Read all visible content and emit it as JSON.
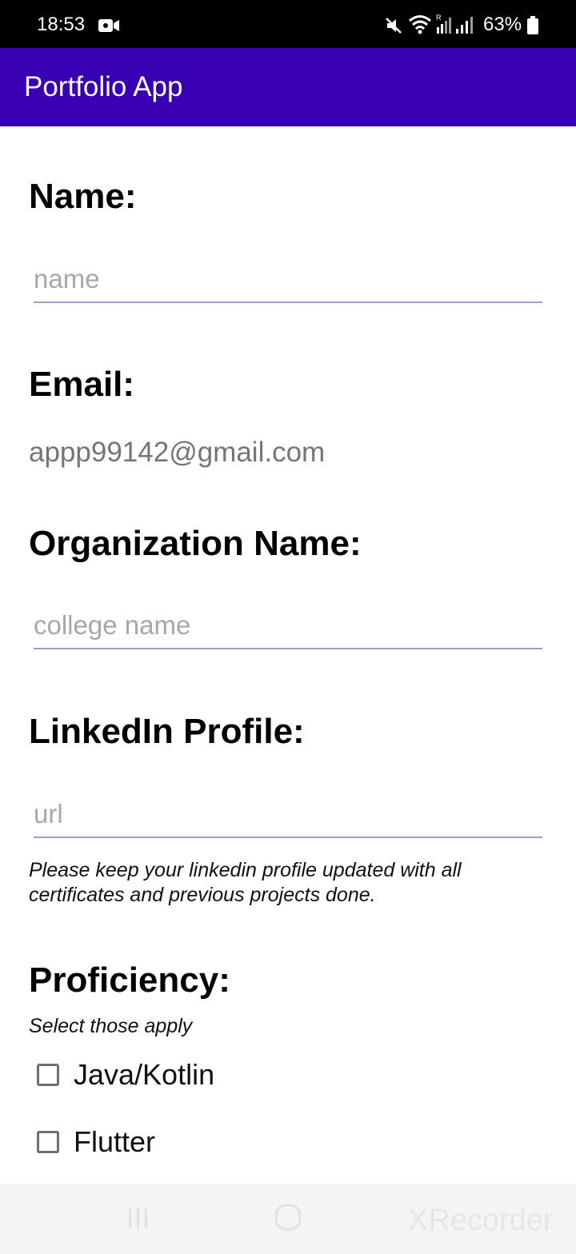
{
  "status_bar": {
    "time": "18:53",
    "battery": "63%",
    "icons": [
      "video-record-icon",
      "mute-icon",
      "wifi-icon",
      "signal-icon",
      "battery-icon"
    ]
  },
  "app_bar": {
    "title": "Portfolio App",
    "color": "#3700b3"
  },
  "form": {
    "name_label": "Name:",
    "name_placeholder": "name",
    "name_value": "",
    "email_label": "Email:",
    "email_value": "appp99142@gmail.com",
    "org_label": "Organization Name:",
    "org_placeholder": "college name",
    "org_value": "",
    "linkedin_label": "LinkedIn Profile:",
    "linkedin_placeholder": "url",
    "linkedin_value": "",
    "linkedin_hint": "Please keep your linkedin profile updated with all certificates and previous projects done.",
    "proficiency_label": "Proficiency:",
    "proficiency_hint": "Select those apply",
    "options": [
      {
        "label": "Java/Kotlin",
        "checked": false
      },
      {
        "label": "Flutter",
        "checked": false
      }
    ]
  },
  "nav_bar": {
    "watermark": "XRecorder"
  }
}
